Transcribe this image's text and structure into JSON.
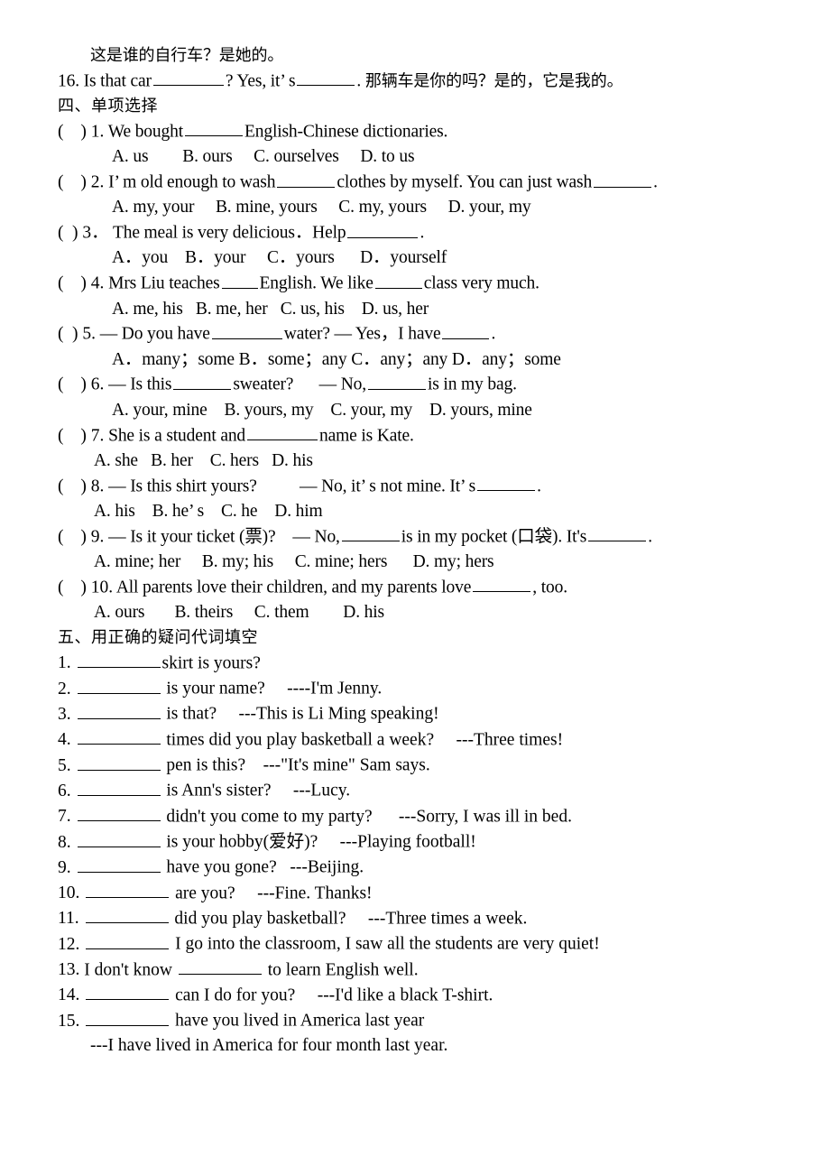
{
  "document": {
    "intro_cn": "这是谁的自行车？是她的。",
    "q16": {
      "num": "16.",
      "text_a": "Is that car",
      "text_b": "? Yes, it’ s",
      "text_c": ".",
      "translation_cn": "那辆车是你的吗？是的，它是我的。"
    }
  },
  "section_four": {
    "heading": "四、单项选择",
    "questions": [
      {
        "marker": "(",
        "marker_close": ") 1.",
        "stem_pre": "We bought",
        "stem_post": "English-Chinese dictionaries.",
        "options": "A. us        B. ours     C. ourselves     D. to us"
      },
      {
        "marker": "(",
        "marker_close": ") 2.",
        "stem_pre": "I’ m old enough to wash",
        "stem_mid": "clothes by myself. You can just wash",
        "stem_post": ".",
        "options": "A. my, your     B. mine, yours     C. my, yours     D. your, my"
      },
      {
        "marker": "(",
        "marker_close": ") 3．",
        "stem_pre": "The meal is very delicious．Help",
        "stem_post": ".",
        "options": "A．you    B．your     C．yours      D．yourself"
      },
      {
        "marker": "(",
        "marker_close": ") 4.",
        "stem_pre": "Mrs Liu teaches",
        "stem_mid": "English. We like",
        "stem_post": "class very much.",
        "options": "A. me, his   B. me, her   C. us, his    D. us, her"
      },
      {
        "marker": "(",
        "marker_close": ") 5.",
        "stem_pre": "— Do you have",
        "stem_mid": "water? — Yes，I have",
        "stem_post": ".",
        "options": "A．many；some B．some；any C．any；any D．any；some"
      },
      {
        "marker": "(",
        "marker_close": ") 6.",
        "stem_pre": "— Is this",
        "stem_mid": "sweater?      — No,",
        "stem_post": "is in my bag.",
        "options": "A. your, mine    B. yours, my    C. your, my    D. yours, mine"
      },
      {
        "marker": "(",
        "marker_close": ") 7.",
        "stem_pre": "She is a student and",
        "stem_post": "name is Kate.",
        "options": "A. she   B. her    C. hers   D. his"
      },
      {
        "marker": "(",
        "marker_close": ") 8.",
        "stem_pre": "— Is this shirt yours?          — No, it’ s not mine. It’ s",
        "stem_post": ".",
        "options": "A. his    B. he’ s    C. he    D. him"
      },
      {
        "marker": "(",
        "marker_close": ") 9.",
        "stem_pre": "— Is it your ticket (票)?    — No,",
        "stem_mid": "is in my pocket (口袋). It's",
        "stem_post": ".",
        "options": "A. mine; her     B. my; his     C. mine; hers      D. my; hers"
      },
      {
        "marker": "(",
        "marker_close": ") 10.",
        "stem_pre": "All parents love their children, and my parents love",
        "stem_post": ", too.",
        "options": "A. ours       B. theirs     C. them        D. his"
      }
    ]
  },
  "section_five": {
    "heading": "五、用正确的疑问代词填空",
    "items": [
      {
        "num": "1.",
        "pre": "",
        "post": "skirt is yours?"
      },
      {
        "num": "2.",
        "pre": "",
        "post": " is your name?     ----I'm Jenny."
      },
      {
        "num": "3.",
        "pre": "",
        "post": " is that?     ---This is Li Ming speaking!"
      },
      {
        "num": "4.",
        "pre": "",
        "post": " times did you play basketball a week?     ---Three times!"
      },
      {
        "num": "5.",
        "pre": "",
        "post": " pen is this?    ---\"It's mine\" Sam says."
      },
      {
        "num": "6.",
        "pre": "",
        "post": " is Ann's sister?     ---Lucy."
      },
      {
        "num": "7.",
        "pre": "",
        "post": " didn't you come to my party?      ---Sorry, I was ill in bed."
      },
      {
        "num": "8.",
        "pre": "",
        "post": " is your hobby(爱好)?     ---Playing football!"
      },
      {
        "num": "9.",
        "pre": "",
        "post": " have you gone?   ---Beijing."
      },
      {
        "num": "10.",
        "pre": "",
        "post": " are you?     ---Fine. Thanks!"
      },
      {
        "num": "11.",
        "pre": "",
        "post": " did you play basketball?     ---Three times a week."
      },
      {
        "num": "12.",
        "pre": "",
        "post": " I go into the classroom, I saw all the students are very quiet!"
      },
      {
        "num": "13.",
        "pre": "I don't know ",
        "post": " to learn English well."
      },
      {
        "num": "14.",
        "pre": "",
        "post": " can I do for you?     ---I'd like a black T-shirt."
      },
      {
        "num": "15.",
        "pre": "",
        "post": " have you lived in America last year"
      }
    ],
    "item15_answer": "---I have lived in America for four month last year."
  }
}
